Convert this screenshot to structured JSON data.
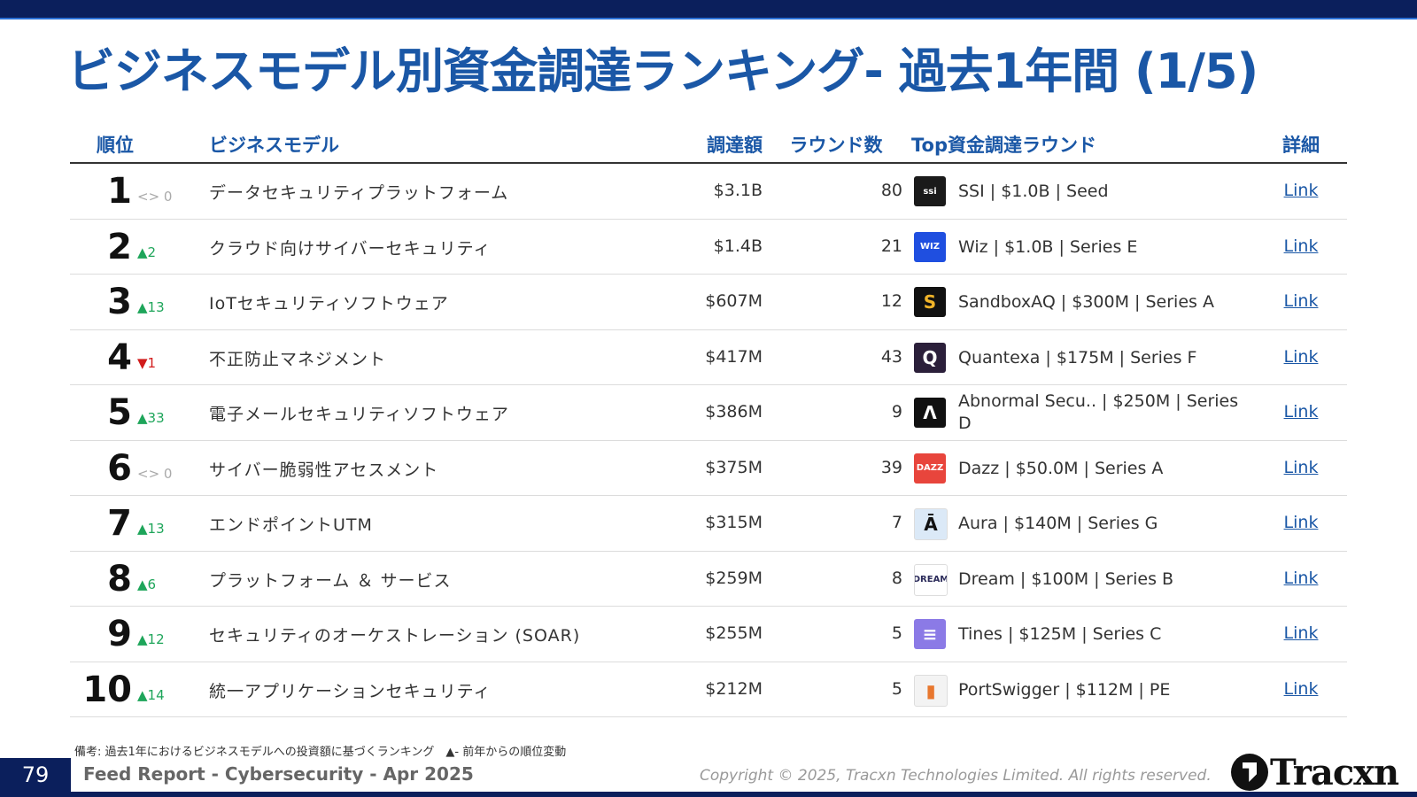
{
  "title": "ビジネスモデル別資金調達ランキング- 過去1年間 (1/5)",
  "headers": {
    "rank": "順位",
    "model": "ビジネスモデル",
    "amount": "調達額",
    "rounds": "ラウンド数",
    "top_round": "Top資金調達ラウンド",
    "detail": "詳細"
  },
  "rows": [
    {
      "rank": "1",
      "change": "<> 0",
      "dir": "same",
      "model": "データセキュリティプラットフォーム",
      "amount": "$3.1B",
      "rounds": "80",
      "logo": "ssi",
      "logo_icon": "ssi-logo-icon",
      "logo_bg": "#1a1a1a",
      "logo_fg": "#ffffff",
      "top_round": "SSI | $1.0B | Seed",
      "link": "Link"
    },
    {
      "rank": "2",
      "change": "▲2",
      "dir": "up",
      "model": "クラウド向けサイバーセキュリティ",
      "amount": "$1.4B",
      "rounds": "21",
      "logo": "WIZ",
      "logo_icon": "wiz-logo-icon",
      "logo_bg": "#1f4fe0",
      "logo_fg": "#ffffff",
      "top_round": "Wiz | $1.0B | Series E",
      "link": "Link"
    },
    {
      "rank": "3",
      "change": "▲13",
      "dir": "up",
      "model": "IoTセキュリティソフトウェア",
      "amount": "$607M",
      "rounds": "12",
      "logo": "S",
      "logo_icon": "sandboxaq-logo-icon",
      "logo_bg": "#111111",
      "logo_fg": "#f0b429",
      "top_round": "SandboxAQ | $300M | Series A",
      "link": "Link"
    },
    {
      "rank": "4",
      "change": "▼1",
      "dir": "down",
      "model": "不正防止マネジメント",
      "amount": "$417M",
      "rounds": "43",
      "logo": "Q",
      "logo_icon": "quantexa-logo-icon",
      "logo_bg": "#2b1f3a",
      "logo_fg": "#ffffff",
      "top_round": "Quantexa | $175M | Series F",
      "link": "Link"
    },
    {
      "rank": "5",
      "change": "▲33",
      "dir": "up",
      "model": "電子メールセキュリティソフトウェア",
      "amount": "$386M",
      "rounds": "9",
      "logo": "Λ",
      "logo_icon": "abnormal-security-logo-icon",
      "logo_bg": "#111111",
      "logo_fg": "#ffffff",
      "top_round": "Abnormal Secu.. | $250M | Series D",
      "link": "Link"
    },
    {
      "rank": "6",
      "change": "<> 0",
      "dir": "same",
      "model": "サイバー脆弱性アセスメント",
      "amount": "$375M",
      "rounds": "39",
      "logo": "DAZZ",
      "logo_icon": "dazz-logo-icon",
      "logo_bg": "#e8453c",
      "logo_fg": "#ffffff",
      "top_round": "Dazz | $50.0M | Series A",
      "link": "Link"
    },
    {
      "rank": "7",
      "change": "▲13",
      "dir": "up",
      "model": "エンドポイントUTM",
      "amount": "$315M",
      "rounds": "7",
      "logo": "Ā",
      "logo_icon": "aura-logo-icon",
      "logo_bg": "#dbe9f7",
      "logo_fg": "#111111",
      "top_round": "Aura | $140M | Series G",
      "link": "Link"
    },
    {
      "rank": "8",
      "change": "▲6",
      "dir": "up",
      "model": "プラットフォーム ＆ サービス",
      "amount": "$259M",
      "rounds": "8",
      "logo": "DREAM",
      "logo_icon": "dream-logo-icon",
      "logo_bg": "#ffffff",
      "logo_fg": "#2b2b5a",
      "top_round": "Dream | $100M | Series B",
      "link": "Link"
    },
    {
      "rank": "9",
      "change": "▲12",
      "dir": "up",
      "model": "セキュリティのオーケストレーション (SOAR)",
      "amount": "$255M",
      "rounds": "5",
      "logo": "≡",
      "logo_icon": "tines-logo-icon",
      "logo_bg": "#8b7ae6",
      "logo_fg": "#ffffff",
      "top_round": "Tines | $125M | Series C",
      "link": "Link"
    },
    {
      "rank": "10",
      "change": "▲14",
      "dir": "up",
      "model": "統一アプリケーションセキュリティ",
      "amount": "$212M",
      "rounds": "5",
      "logo": "▮",
      "logo_icon": "portswigger-logo-icon",
      "logo_bg": "#f3f3f3",
      "logo_fg": "#e8772e",
      "top_round": "PortSwigger | $112M | PE",
      "link": "Link"
    }
  ],
  "footnote": "備考: 過去1年におけるビジネスモデルへの投資額に基づくランキング　▲- 前年からの順位変動",
  "page_number": "79",
  "report_name": "Feed Report - Cybersecurity - Apr 2025",
  "copyright": "Copyright © 2025, Tracxn Technologies Limited. All rights reserved.",
  "brand": "Tracxn"
}
